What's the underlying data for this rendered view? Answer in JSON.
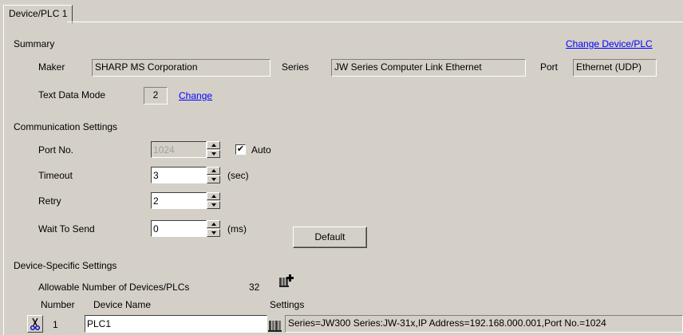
{
  "tab": {
    "label": "Device/PLC 1"
  },
  "summary": {
    "heading": "Summary",
    "change_link": "Change Device/PLC",
    "maker_label": "Maker",
    "maker_value": "SHARP MS Corporation",
    "series_label": "Series",
    "series_value": "JW Series Computer Link Ethernet",
    "port_label": "Port",
    "port_value": "Ethernet (UDP)",
    "text_mode_label": "Text Data Mode",
    "text_mode_value": "2",
    "text_mode_change": "Change"
  },
  "comm": {
    "heading": "Communication Settings",
    "port_label": "Port No.",
    "port_value": "1024",
    "auto_label": "Auto",
    "auto_checked": true,
    "timeout_label": "Timeout",
    "timeout_value": "3",
    "timeout_unit": "(sec)",
    "retry_label": "Retry",
    "retry_value": "2",
    "wait_label": "Wait To Send",
    "wait_value": "0",
    "wait_unit": "(ms)",
    "default_button": "Default"
  },
  "device": {
    "heading": "Device-Specific Settings",
    "allowable_label": "Allowable Number of Devices/PLCs",
    "allowable_value": "32",
    "col_number": "Number",
    "col_name": "Device Name",
    "col_settings": "Settings",
    "rows": [
      {
        "number": "1",
        "name": "PLC1",
        "settings": "Series=JW300 Series:JW-31x,IP Address=192.168.000.001,Port No.=1024"
      }
    ]
  },
  "colors": {
    "panel": "#d4d0c8",
    "link": "#0000ff"
  }
}
